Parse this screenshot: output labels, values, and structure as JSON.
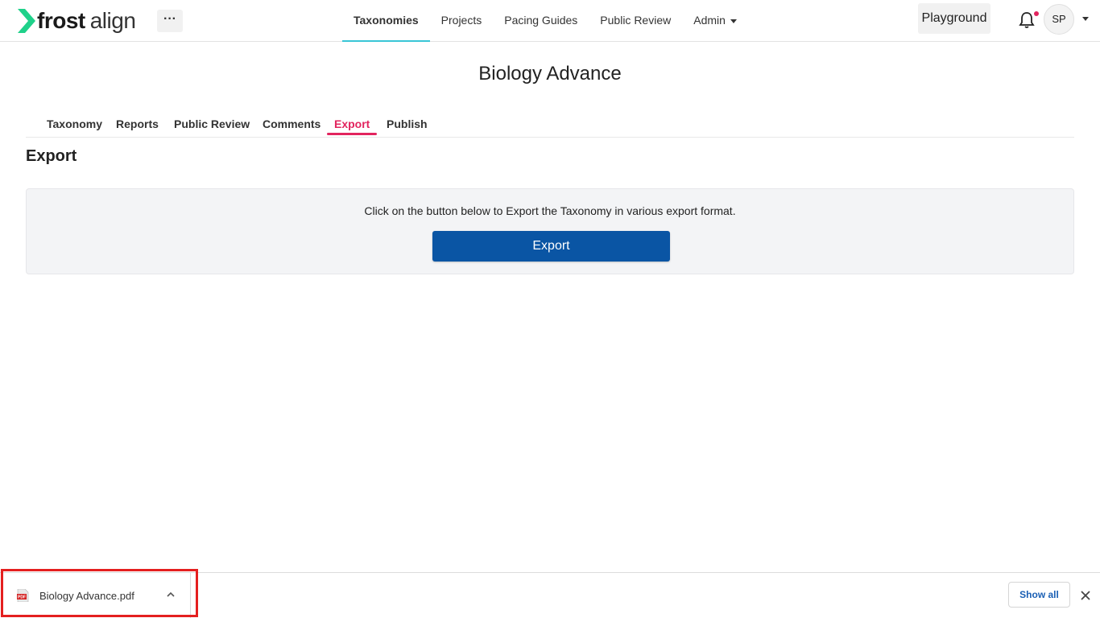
{
  "app": {
    "logo_bold": "frost",
    "logo_light": "align",
    "more_label": "···",
    "accent": "#39c6d6",
    "brand_green": "#1fd18a"
  },
  "nav": {
    "items": [
      {
        "label": "Taxonomies",
        "active": true
      },
      {
        "label": "Projects"
      },
      {
        "label": "Pacing Guides"
      },
      {
        "label": "Public Review"
      },
      {
        "label": "Admin",
        "dropdown": true
      }
    ]
  },
  "header_right": {
    "playground_label": "Playground",
    "avatar_initials": "SP",
    "notification_dot_color": "#e2245e"
  },
  "page": {
    "title": "Biology Advance",
    "tabs": [
      {
        "label": "Taxonomy"
      },
      {
        "label": "Reports"
      },
      {
        "label": "Public Review"
      },
      {
        "label": "Comments"
      },
      {
        "label": "Export",
        "active": true
      },
      {
        "label": "Publish"
      }
    ],
    "active_tab_color": "#e2245e",
    "section_title": "Export",
    "export_description": "Click on the button below to Export the Taxonomy in various export format.",
    "export_button_label": "Export",
    "export_button_color": "#0a55a4"
  },
  "download_bar": {
    "file_name": "Biology Advance.pdf",
    "file_icon": "pdf-file-icon",
    "show_all_label": "Show all",
    "highlight_color": "#e41f1f"
  }
}
